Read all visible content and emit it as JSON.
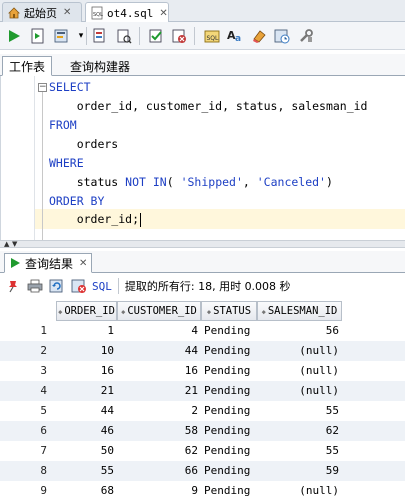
{
  "file_tabs": [
    {
      "label": "起始页",
      "active": false
    },
    {
      "label": "ot4.sql",
      "active": true
    }
  ],
  "worksheet_tabs": [
    {
      "label": "工作表",
      "active": true
    },
    {
      "label": "查询构建器",
      "active": false
    }
  ],
  "editor": {
    "fold_glyph": "−",
    "lines": [
      {
        "kw": "SELECT"
      },
      {
        "text": "    order_id, customer_id, status, salesman_id"
      },
      {
        "kw": "FROM"
      },
      {
        "text": "    orders"
      },
      {
        "kw": "WHERE"
      },
      {
        "pre": "    status ",
        "kw2": "NOT IN",
        "mid": "( ",
        "s1": "'Shipped'",
        "comma": ", ",
        "s2": "'Canceled'",
        "post": ")"
      },
      {
        "kw": "ORDER BY"
      },
      {
        "text": "    order_id;"
      }
    ]
  },
  "results": {
    "tab_label": "查询结果",
    "sql_label": "SQL",
    "status_text": "提取的所有行: 18, 用时 0.008 秒",
    "columns": [
      "ORDER_ID",
      "CUSTOMER_ID",
      "STATUS",
      "SALESMAN_ID"
    ],
    "rows": [
      {
        "n": "1",
        "order_id": "1",
        "customer_id": "4",
        "status": "Pending",
        "salesman_id": "56"
      },
      {
        "n": "2",
        "order_id": "10",
        "customer_id": "44",
        "status": "Pending",
        "salesman_id": "(null)"
      },
      {
        "n": "3",
        "order_id": "16",
        "customer_id": "16",
        "status": "Pending",
        "salesman_id": "(null)"
      },
      {
        "n": "4",
        "order_id": "21",
        "customer_id": "21",
        "status": "Pending",
        "salesman_id": "(null)"
      },
      {
        "n": "5",
        "order_id": "44",
        "customer_id": "2",
        "status": "Pending",
        "salesman_id": "55"
      },
      {
        "n": "6",
        "order_id": "46",
        "customer_id": "58",
        "status": "Pending",
        "salesman_id": "62"
      },
      {
        "n": "7",
        "order_id": "50",
        "customer_id": "62",
        "status": "Pending",
        "salesman_id": "55"
      },
      {
        "n": "8",
        "order_id": "55",
        "customer_id": "66",
        "status": "Pending",
        "salesman_id": "59"
      },
      {
        "n": "9",
        "order_id": "68",
        "customer_id": "9",
        "status": "Pending",
        "salesman_id": "(null)"
      }
    ]
  },
  "colors": {
    "keyword": "#1d3fc4",
    "current_line": "#fff7dc",
    "run_green": "#1f9a2e"
  },
  "icons": {
    "run": "play-icon",
    "run_script": "run-script-icon",
    "explain": "explain-plan-icon",
    "commit": "commit-icon",
    "rollback": "rollback-icon",
    "pin": "pin-icon",
    "print": "print-icon",
    "refresh": "refresh-icon",
    "delete": "delete-icon"
  }
}
